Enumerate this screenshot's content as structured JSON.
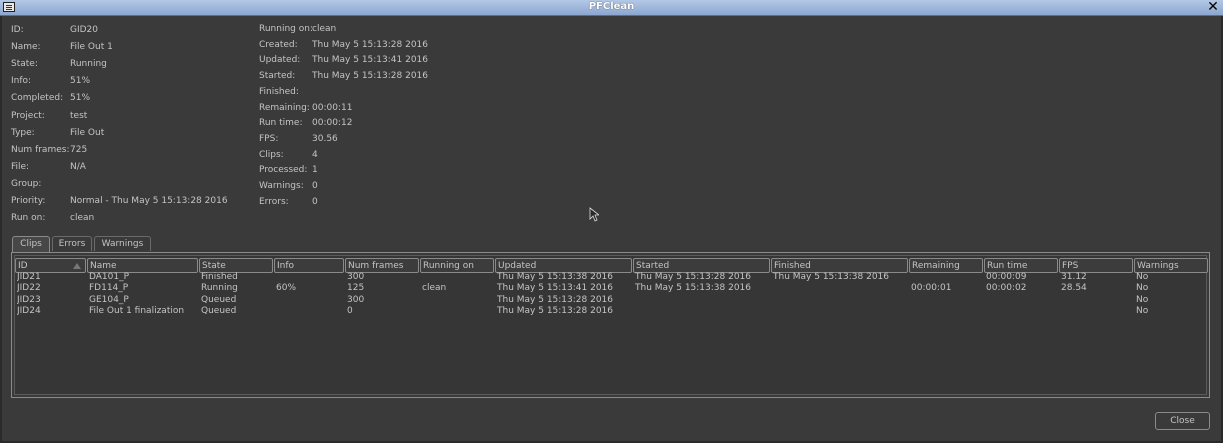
{
  "window": {
    "title": "PFClean"
  },
  "details_left": [
    {
      "label": "ID:",
      "value": "GID20"
    },
    {
      "label": "Name:",
      "value": "File Out 1"
    },
    {
      "label": "State:",
      "value": "Running"
    },
    {
      "label": "Info:",
      "value": "51%"
    },
    {
      "label": "Completed:",
      "value": "51%"
    },
    {
      "label": "Project:",
      "value": "test"
    },
    {
      "label": "Type:",
      "value": "File Out"
    },
    {
      "label": "Num frames:",
      "value": "725"
    },
    {
      "label": "File:",
      "value": "N/A"
    },
    {
      "label": "Group:",
      "value": ""
    },
    {
      "label": "Priority:",
      "value": "Normal - Thu May 5 15:13:28 2016"
    },
    {
      "label": "Run on:",
      "value": "clean"
    }
  ],
  "details_right": [
    {
      "label": "Running on:",
      "value": "clean"
    },
    {
      "label": "Created:",
      "value": "Thu May 5 15:13:28 2016"
    },
    {
      "label": "Updated:",
      "value": "Thu May 5 15:13:41 2016"
    },
    {
      "label": "Started:",
      "value": "Thu May 5 15:13:28 2016"
    },
    {
      "label": "Finished:",
      "value": ""
    },
    {
      "label": "Remaining:",
      "value": "00:00:11"
    },
    {
      "label": "Run time:",
      "value": "00:00:12"
    },
    {
      "label": "FPS:",
      "value": "30.56"
    },
    {
      "label": "Clips:",
      "value": "4"
    },
    {
      "label": "Processed:",
      "value": "1"
    },
    {
      "label": "Warnings:",
      "value": "0"
    },
    {
      "label": "Errors:",
      "value": "0"
    }
  ],
  "tabs": [
    "Clips",
    "Errors",
    "Warnings"
  ],
  "active_tab": "Clips",
  "table": {
    "columns": [
      "ID",
      "Name",
      "State",
      "Info",
      "Num frames",
      "Running on",
      "Updated",
      "Started",
      "Finished",
      "Remaining",
      "Run time",
      "FPS",
      "Warnings"
    ],
    "rows": [
      [
        "JID21",
        "DA101_P",
        "Finished",
        "",
        "300",
        "",
        "Thu May 5 15:13:38 2016",
        "Thu May 5 15:13:28 2016",
        "Thu May 5 15:13:38 2016",
        "",
        "00:00:09",
        "31.12",
        "No"
      ],
      [
        "JID22",
        "FD114_P",
        "Running",
        "60%",
        "125",
        "clean",
        "Thu May 5 15:13:41 2016",
        "Thu May 5 15:13:38 2016",
        "",
        "00:00:01",
        "00:00:02",
        "28.54",
        "No"
      ],
      [
        "JID23",
        "GE104_P",
        "Queued",
        "",
        "300",
        "",
        "Thu May 5 15:13:28 2016",
        "",
        "",
        "",
        "",
        "",
        "No"
      ],
      [
        "JID24",
        "File Out 1 finalization",
        "Queued",
        "",
        "0",
        "",
        "Thu May 5 15:13:28 2016",
        "",
        "",
        "",
        "",
        "",
        "No"
      ]
    ]
  },
  "buttons": {
    "close": "Close"
  },
  "colors": {
    "titlebar": "#8ba6d0",
    "background": "#3a3a3a",
    "text": "#c4c4c4"
  }
}
